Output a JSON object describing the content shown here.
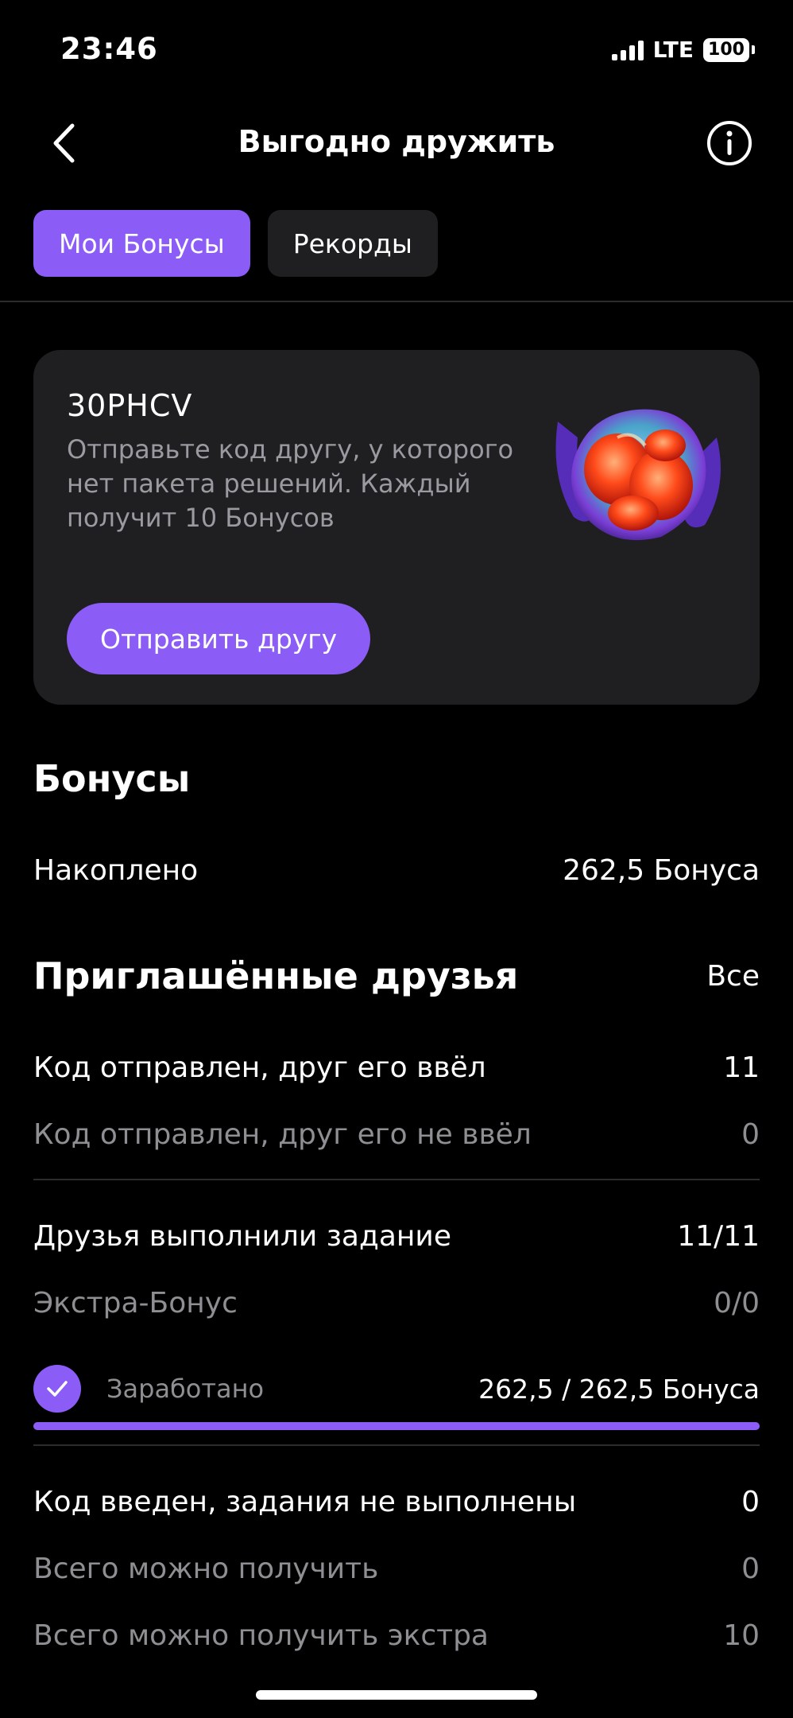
{
  "status_bar": {
    "time": "23:46",
    "network": "LTE",
    "battery": "100"
  },
  "header": {
    "title": "Выгодно дружить"
  },
  "tabs": [
    {
      "label": "Мои Бонусы",
      "active": true
    },
    {
      "label": "Рекорды",
      "active": false
    }
  ],
  "invite_card": {
    "code": "30PHCV",
    "description": "Отправьте код другу, у которого нет пакета решений. Каждый получит 10 Бонусов",
    "button_label": "Отправить другу"
  },
  "bonuses": {
    "title": "Бонусы",
    "accumulated_label": "Накоплено",
    "accumulated_value": "262,5 Бонуса"
  },
  "friends": {
    "title": "Приглашённые друзья",
    "all_link": "Все",
    "rows": [
      {
        "label": "Код отправлен, друг его ввёл",
        "value": "11"
      },
      {
        "label": "Код отправлен, друг его не ввёл",
        "value": "0"
      },
      {
        "label": "Друзья выполнили задание",
        "value": "11/11"
      },
      {
        "label": "Экстра-Бонус",
        "value": "0/0"
      }
    ],
    "earned": {
      "label": "Заработано",
      "value": "262,5 / 262,5 Бонуса",
      "progress": 1.0
    },
    "bottom_rows": [
      {
        "label": "Код введен, задания не выполнены",
        "value": "0"
      },
      {
        "label": "Всего можно получить",
        "value": "0"
      },
      {
        "label": "Всего можно получить экстра",
        "value": "10"
      }
    ]
  },
  "colors": {
    "accent": "#8b5cf6",
    "card": "#1f1f21",
    "muted": "#8e8e93"
  }
}
